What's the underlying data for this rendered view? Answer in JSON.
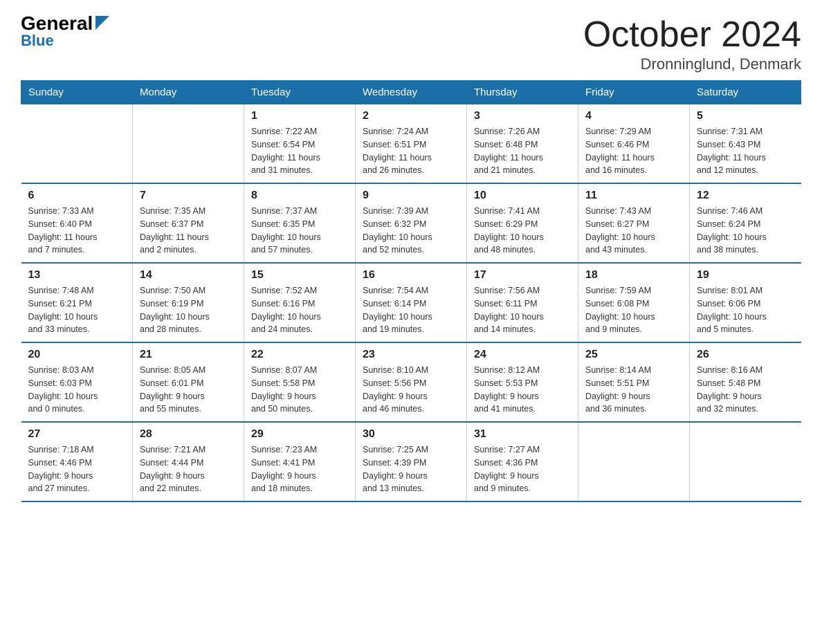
{
  "logo": {
    "line1_black": "General",
    "line1_blue": "Blue",
    "line2": "Blue"
  },
  "title": "October 2024",
  "subtitle": "Dronninglund, Denmark",
  "days_of_week": [
    "Sunday",
    "Monday",
    "Tuesday",
    "Wednesday",
    "Thursday",
    "Friday",
    "Saturday"
  ],
  "weeks": [
    [
      {
        "day": "",
        "info": ""
      },
      {
        "day": "",
        "info": ""
      },
      {
        "day": "1",
        "info": "Sunrise: 7:22 AM\nSunset: 6:54 PM\nDaylight: 11 hours\nand 31 minutes."
      },
      {
        "day": "2",
        "info": "Sunrise: 7:24 AM\nSunset: 6:51 PM\nDaylight: 11 hours\nand 26 minutes."
      },
      {
        "day": "3",
        "info": "Sunrise: 7:26 AM\nSunset: 6:48 PM\nDaylight: 11 hours\nand 21 minutes."
      },
      {
        "day": "4",
        "info": "Sunrise: 7:29 AM\nSunset: 6:46 PM\nDaylight: 11 hours\nand 16 minutes."
      },
      {
        "day": "5",
        "info": "Sunrise: 7:31 AM\nSunset: 6:43 PM\nDaylight: 11 hours\nand 12 minutes."
      }
    ],
    [
      {
        "day": "6",
        "info": "Sunrise: 7:33 AM\nSunset: 6:40 PM\nDaylight: 11 hours\nand 7 minutes."
      },
      {
        "day": "7",
        "info": "Sunrise: 7:35 AM\nSunset: 6:37 PM\nDaylight: 11 hours\nand 2 minutes."
      },
      {
        "day": "8",
        "info": "Sunrise: 7:37 AM\nSunset: 6:35 PM\nDaylight: 10 hours\nand 57 minutes."
      },
      {
        "day": "9",
        "info": "Sunrise: 7:39 AM\nSunset: 6:32 PM\nDaylight: 10 hours\nand 52 minutes."
      },
      {
        "day": "10",
        "info": "Sunrise: 7:41 AM\nSunset: 6:29 PM\nDaylight: 10 hours\nand 48 minutes."
      },
      {
        "day": "11",
        "info": "Sunrise: 7:43 AM\nSunset: 6:27 PM\nDaylight: 10 hours\nand 43 minutes."
      },
      {
        "day": "12",
        "info": "Sunrise: 7:46 AM\nSunset: 6:24 PM\nDaylight: 10 hours\nand 38 minutes."
      }
    ],
    [
      {
        "day": "13",
        "info": "Sunrise: 7:48 AM\nSunset: 6:21 PM\nDaylight: 10 hours\nand 33 minutes."
      },
      {
        "day": "14",
        "info": "Sunrise: 7:50 AM\nSunset: 6:19 PM\nDaylight: 10 hours\nand 28 minutes."
      },
      {
        "day": "15",
        "info": "Sunrise: 7:52 AM\nSunset: 6:16 PM\nDaylight: 10 hours\nand 24 minutes."
      },
      {
        "day": "16",
        "info": "Sunrise: 7:54 AM\nSunset: 6:14 PM\nDaylight: 10 hours\nand 19 minutes."
      },
      {
        "day": "17",
        "info": "Sunrise: 7:56 AM\nSunset: 6:11 PM\nDaylight: 10 hours\nand 14 minutes."
      },
      {
        "day": "18",
        "info": "Sunrise: 7:59 AM\nSunset: 6:08 PM\nDaylight: 10 hours\nand 9 minutes."
      },
      {
        "day": "19",
        "info": "Sunrise: 8:01 AM\nSunset: 6:06 PM\nDaylight: 10 hours\nand 5 minutes."
      }
    ],
    [
      {
        "day": "20",
        "info": "Sunrise: 8:03 AM\nSunset: 6:03 PM\nDaylight: 10 hours\nand 0 minutes."
      },
      {
        "day": "21",
        "info": "Sunrise: 8:05 AM\nSunset: 6:01 PM\nDaylight: 9 hours\nand 55 minutes."
      },
      {
        "day": "22",
        "info": "Sunrise: 8:07 AM\nSunset: 5:58 PM\nDaylight: 9 hours\nand 50 minutes."
      },
      {
        "day": "23",
        "info": "Sunrise: 8:10 AM\nSunset: 5:56 PM\nDaylight: 9 hours\nand 46 minutes."
      },
      {
        "day": "24",
        "info": "Sunrise: 8:12 AM\nSunset: 5:53 PM\nDaylight: 9 hours\nand 41 minutes."
      },
      {
        "day": "25",
        "info": "Sunrise: 8:14 AM\nSunset: 5:51 PM\nDaylight: 9 hours\nand 36 minutes."
      },
      {
        "day": "26",
        "info": "Sunrise: 8:16 AM\nSunset: 5:48 PM\nDaylight: 9 hours\nand 32 minutes."
      }
    ],
    [
      {
        "day": "27",
        "info": "Sunrise: 7:18 AM\nSunset: 4:46 PM\nDaylight: 9 hours\nand 27 minutes."
      },
      {
        "day": "28",
        "info": "Sunrise: 7:21 AM\nSunset: 4:44 PM\nDaylight: 9 hours\nand 22 minutes."
      },
      {
        "day": "29",
        "info": "Sunrise: 7:23 AM\nSunset: 4:41 PM\nDaylight: 9 hours\nand 18 minutes."
      },
      {
        "day": "30",
        "info": "Sunrise: 7:25 AM\nSunset: 4:39 PM\nDaylight: 9 hours\nand 13 minutes."
      },
      {
        "day": "31",
        "info": "Sunrise: 7:27 AM\nSunset: 4:36 PM\nDaylight: 9 hours\nand 9 minutes."
      },
      {
        "day": "",
        "info": ""
      },
      {
        "day": "",
        "info": ""
      }
    ]
  ]
}
